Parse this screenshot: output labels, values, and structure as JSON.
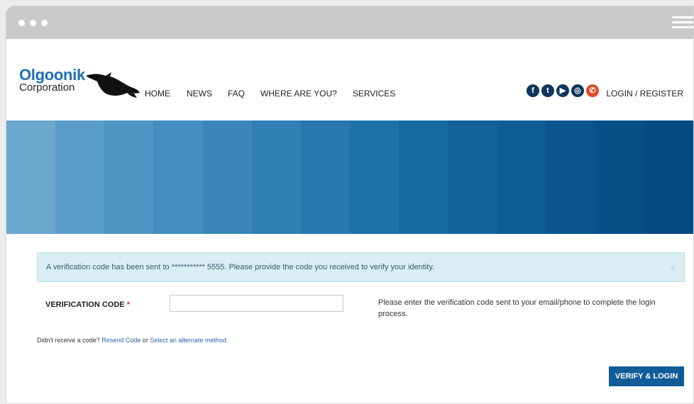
{
  "brand": {
    "name": "Olgoonik",
    "subtitle": "Corporation"
  },
  "nav": {
    "items": [
      {
        "label": "HOME"
      },
      {
        "label": "NEWS"
      },
      {
        "label": "FAQ"
      },
      {
        "label": "WHERE ARE YOU?"
      },
      {
        "label": "SERVICES"
      }
    ],
    "login_label": "LOGIN / REGISTER"
  },
  "social": {
    "icons": [
      "facebook-icon",
      "twitter-icon",
      "youtube-icon",
      "instagram-icon",
      "phone-icon"
    ],
    "glyphs": [
      "f",
      "t",
      "▶",
      "◎",
      "✆"
    ]
  },
  "banner": {
    "colors": [
      "#6aa7cf",
      "#5b9dc9",
      "#4f95c4",
      "#448dbf",
      "#3a86ba",
      "#307fb5",
      "#2778b0",
      "#1f71aa",
      "#186aa3",
      "#12639c",
      "#0d5c95",
      "#09568e",
      "#065087",
      "#044a80"
    ]
  },
  "alert": {
    "text": "A verification code has been sent to *********** 5555. Please provide the code you received to verify your identity.",
    "close": "×",
    "background": "#d9edf5"
  },
  "form": {
    "label": "VERIFICATION CODE",
    "required_mark": "*",
    "input_value": "",
    "help_text": "Please enter the verification code sent to your email/phone to complete the login process."
  },
  "resend": {
    "prefix": "Didn't receive a code?",
    "resend_link": "Resend Code",
    "or": "or",
    "alternate_link": "Select an alternate method"
  },
  "actions": {
    "verify_label": "VERIFY & LOGIN",
    "button_color": "#0f5c99"
  }
}
